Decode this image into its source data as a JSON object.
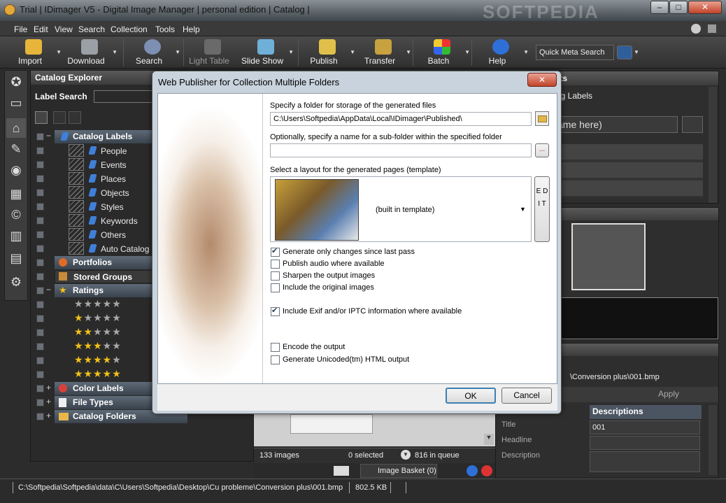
{
  "window": {
    "title": "Trial | IDimager V5 - Digital Image Manager | personal edition | Catalog |",
    "minimize_glyph": "–",
    "maximize_glyph": "□",
    "close_glyph": "✕"
  },
  "menu": [
    "File",
    "Edit",
    "View",
    "Search",
    "Collection",
    "Tools",
    "Help"
  ],
  "toolbar": {
    "buttons": [
      {
        "label": "Import",
        "icon": "import-icon"
      },
      {
        "label": "Download",
        "icon": "camera-icon"
      },
      {
        "label": "Search",
        "icon": "search-icon"
      },
      {
        "label": "Light Table",
        "icon": "light-table-icon"
      },
      {
        "label": "Slide Show",
        "icon": "monitor-icon"
      },
      {
        "label": "Publish",
        "icon": "publish-icon"
      },
      {
        "label": "Transfer",
        "icon": "transfer-icon"
      },
      {
        "label": "Batch",
        "icon": "batch-icon"
      },
      {
        "label": "Help",
        "icon": "help-icon"
      }
    ],
    "quick_search_label": "Quick Meta Search"
  },
  "explorer": {
    "title": "Catalog Explorer",
    "label_search": "Label Search",
    "groups": {
      "catalog_labels": "Catalog Labels",
      "portfolios": "Portfolios",
      "stored_groups": "Stored Groups",
      "ratings": "Ratings",
      "color_labels": "Color Labels",
      "file_types": "File Types",
      "catalog_folders": "Catalog Folders"
    },
    "labels": [
      "People",
      "Events",
      "Places",
      "Objects",
      "Styles",
      "Keywords",
      "Others",
      "Auto Catalog"
    ],
    "ratings": [
      0,
      1,
      2,
      3,
      4,
      5
    ]
  },
  "right": {
    "panel_title_fragment": "nts",
    "catalog_labels_fragment": "og Labels",
    "name_field_fragment": "ame here)",
    "path_fragment": "\\Conversion plus\\001.bmp",
    "apply_label": "Apply",
    "descriptions_header": "Descriptions",
    "title_label": "Title",
    "title_value": "001",
    "headline_label": "Headline",
    "description_label": "Description"
  },
  "center": {
    "images_count": "133 images",
    "selected_count": "0 selected",
    "queue_count": "816 in queue",
    "image_basket": "Image Basket (0)"
  },
  "dialog": {
    "title": "Web Publisher for Collection Multiple Folders",
    "folder_label": "Specify a folder for storage of the generated files",
    "folder_value": "C:\\Users\\Softpedia\\AppData\\Local\\IDimager\\Published\\",
    "subfolder_label": "Optionally, specify a name for a sub-folder within the specified folder",
    "subfolder_value": "",
    "browse_glyph": "...",
    "layout_label": "Select a layout for the generated pages (template)",
    "layout_value": "(built in template)",
    "edit_label": "E D I T",
    "options": [
      {
        "label": "Generate only changes since last pass",
        "checked": true
      },
      {
        "label": "Publish audio where available",
        "checked": false
      },
      {
        "label": "Sharpen the output images",
        "checked": false
      },
      {
        "label": "Include the original images",
        "checked": false
      },
      {
        "label": "Include Exif and/or IPTC information where available",
        "checked": true
      },
      {
        "label": "Encode the output",
        "checked": false
      },
      {
        "label": "Generate Unicoded(tm) HTML output",
        "checked": false
      }
    ],
    "ok_label": "OK",
    "cancel_label": "Cancel"
  },
  "status": {
    "path": "C:\\Softpedia\\Softpedia\\data\\C\\Users\\Softpedia\\Desktop\\Cu probleme\\Conversion plus\\001.bmp",
    "size": "802.5 KB"
  },
  "watermark": "SOFTPEDIA",
  "colors": {
    "dialog_bg": "#c9d3dd",
    "ok_border": "#3c7fb1",
    "group_header": "#4b5562",
    "star": "#f2c117"
  }
}
